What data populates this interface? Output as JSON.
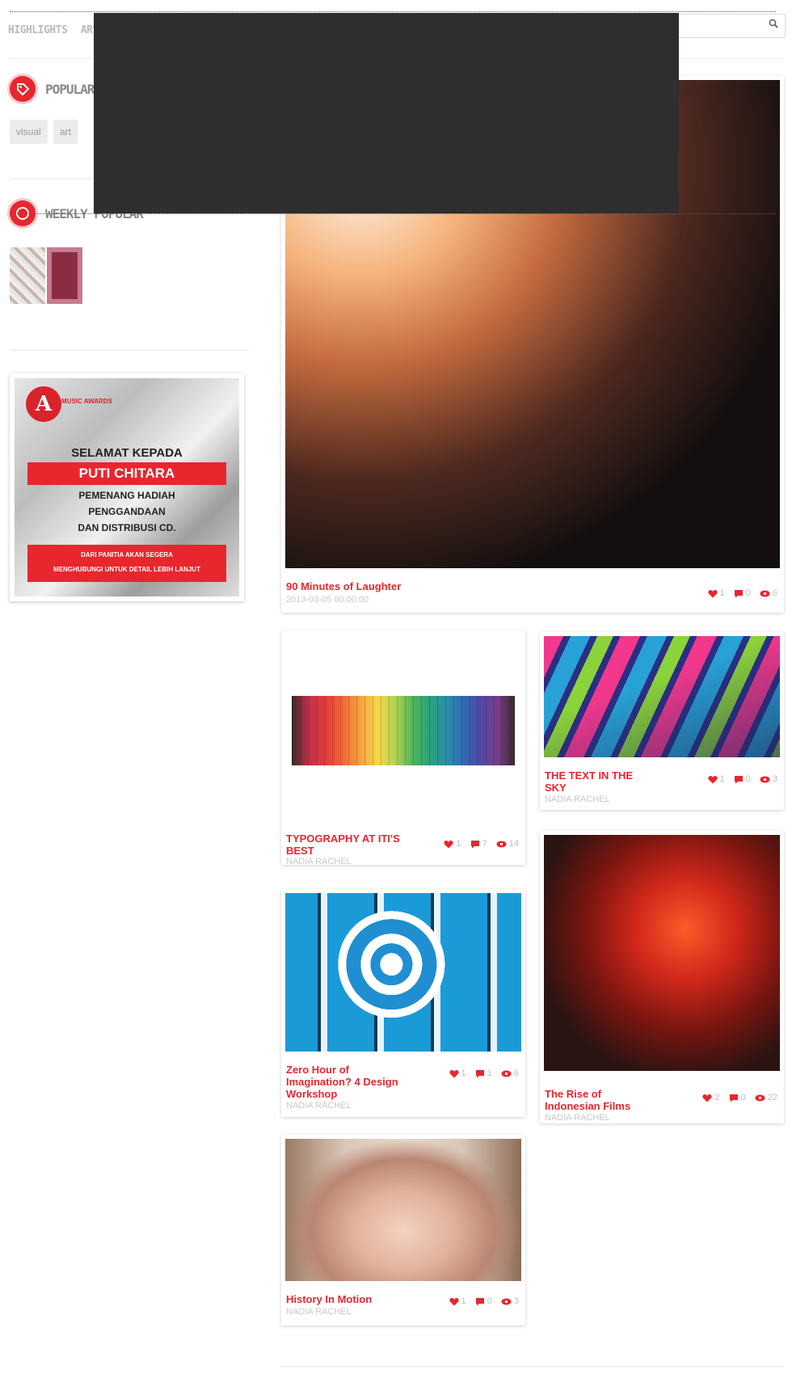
{
  "nav": {
    "items": [
      "HIGHLIGHTS",
      "ARTIC"
    ]
  },
  "search": {
    "placeholder": ""
  },
  "sidebar": {
    "popular_tags": {
      "title": "POPULAR",
      "tags": [
        "visual",
        "art"
      ]
    },
    "weekly_popular": {
      "title": "WEEKLY POPULAR"
    },
    "banner": {
      "logo_letter": "A",
      "brand": "MUSIC AWARDS",
      "line1": "SELAMAT KEPADA",
      "name": "PUTI CHITARA",
      "line2": "PEMENANG HADIAH",
      "line3": "PENGGANDAAN",
      "line4": "DAN DISTRIBUSI CD.",
      "note1": "DARI PANITIA AKAN SEGERA",
      "note2": "MENGHUBUNGI UNTUK DETAIL LEBIH LANJUT"
    }
  },
  "posts": {
    "featured": {
      "title": "90 Minutes of Laughter",
      "meta": "2013-03-05 00:00:00",
      "likes": "1",
      "comments": "0",
      "views": "6"
    },
    "p1": {
      "title": "TYPOGRAPHY AT ITI'S BEST",
      "author": "NADIA RACHEL",
      "likes": "1",
      "comments": "7",
      "views": "14"
    },
    "p2": {
      "title": "THE TEXT IN THE SKY",
      "author": "NADIA RACHEL",
      "likes": "1",
      "comments": "0",
      "views": "3"
    },
    "p3": {
      "title": "Zero Hour of Imagination? 4 Design Workshop",
      "author": "NADIA RACHEL",
      "likes": "1",
      "comments": "1",
      "views": "6"
    },
    "p4": {
      "title": "The Rise of Indonesian Films",
      "author": "NADIA RACHEL",
      "likes": "2",
      "comments": "0",
      "views": "22"
    },
    "p5": {
      "title": "History In Motion",
      "author": "NADIA RACHEL",
      "likes": "1",
      "comments": "0",
      "views": "3"
    }
  },
  "colors": {
    "accent": "#e8262e",
    "overlay": "#2e2e2e"
  }
}
